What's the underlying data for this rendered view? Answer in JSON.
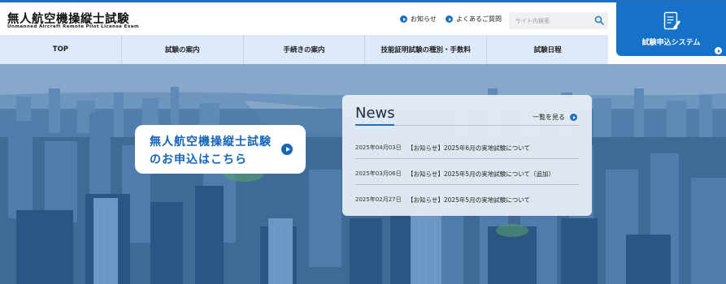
{
  "header": {
    "logo_title": "無人航空機操縦士試験",
    "logo_subtitle": "Unmanned Aircraft Remote Pilot License Exam",
    "links": [
      {
        "label": "お知らせ",
        "icon": "arrow-circle-icon"
      },
      {
        "label": "よくあるご質問",
        "icon": "arrow-circle-icon"
      }
    ],
    "search": {
      "placeholder": "サイト内検索",
      "value": ""
    }
  },
  "nav": {
    "items": [
      "TOP",
      "試験の案内",
      "手続きの案内",
      "技能証明試験の種別・手数料",
      "試験日程"
    ]
  },
  "apply": {
    "label": "試験申込システム",
    "icon": "application-form-icon"
  },
  "hero": {
    "cta_line1": "無人航空機操縦士試験",
    "cta_line2": "のお申込はこちら"
  },
  "news": {
    "title": "News",
    "more_label": "一覧を見る",
    "items": [
      {
        "date": "2025年04月03日",
        "title": "【お知らせ】2025年6月の実地試験について"
      },
      {
        "date": "2025年03月06日",
        "title": "【お知らせ】2025年5月の実地試験について（追加）"
      },
      {
        "date": "2025年02月27日",
        "title": "【お知らせ】2025年5月の実地試験について"
      }
    ]
  },
  "colors": {
    "accent": "#1f6fc0",
    "apply_bg": "#1672c8",
    "nav_bg": "#dde9f6",
    "cta_text": "#1565b8"
  }
}
